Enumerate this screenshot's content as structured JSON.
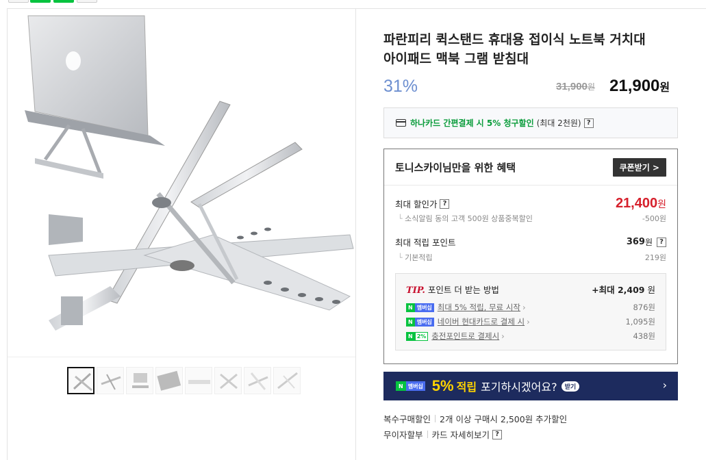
{
  "product": {
    "title_line1": "파란피리 퀵스탠드 휴대용 접이식 노트북 거치대",
    "title_line2": "아이패드 맥북 그램 받침대",
    "discount_rate": "31%",
    "original_price": "31,900",
    "original_unit": "원",
    "sale_price": "21,900",
    "sale_unit": "원"
  },
  "card_promo": {
    "highlight": "하나카드 간편결제 시 5% 청구할인",
    "note": "(최대 2천원)",
    "help": "?"
  },
  "benefit": {
    "heading": "토니스카이님만을 위한 혜택",
    "coupon_button": "쿠폰받기 >",
    "max_price_label": "최대 할인가",
    "max_price_help": "?",
    "max_price": "21,400",
    "max_price_unit": "원",
    "max_price_sub_label": "소식알림 동의 고객 500원 상품중복할인",
    "max_price_sub_value": "-500원",
    "points_label": "최대 적립 포인트",
    "points_value": "369",
    "points_unit": "원",
    "points_help": "?",
    "points_sub_label": "기본적립",
    "points_sub_value": "219원"
  },
  "tip": {
    "tip_word": "TIP.",
    "heading": "포인트 더 받는 방법",
    "max_prefix": "+최대 ",
    "max_value": "2,409",
    "max_unit": " 원",
    "rows": [
      {
        "badge_n": "N",
        "badge_m": "멤버십",
        "text": "최대 5% 적립, 무료 시작",
        "value": "876원"
      },
      {
        "badge_n": "N",
        "badge_m": "멤버십",
        "text": "네이버 현대카드로 결제 시",
        "value": "1,095원"
      },
      {
        "badge_n": "N",
        "badge_m": "2%",
        "text": "충전포인트로 결제시",
        "value": "438원"
      }
    ]
  },
  "banner": {
    "badge_n": "N",
    "badge_m": "멤버십",
    "big": "5%",
    "mid": "적립",
    "rest": "포기하시겠어요?",
    "pill": "받기",
    "arrow": "›"
  },
  "info": {
    "bulk_label": "복수구매할인",
    "bulk_text": "2개 이상 구매시 2,500원 추가할인",
    "installment_label": "무이자할부",
    "installment_link": "카드 자세히보기",
    "installment_help": "?"
  },
  "colors": {
    "discount_blue": "#6d8fd0",
    "sale_red": "#d6202c",
    "naver_green": "#06c33f",
    "banner_navy": "#1d2b5e",
    "banner_yellow": "#ffd400"
  }
}
